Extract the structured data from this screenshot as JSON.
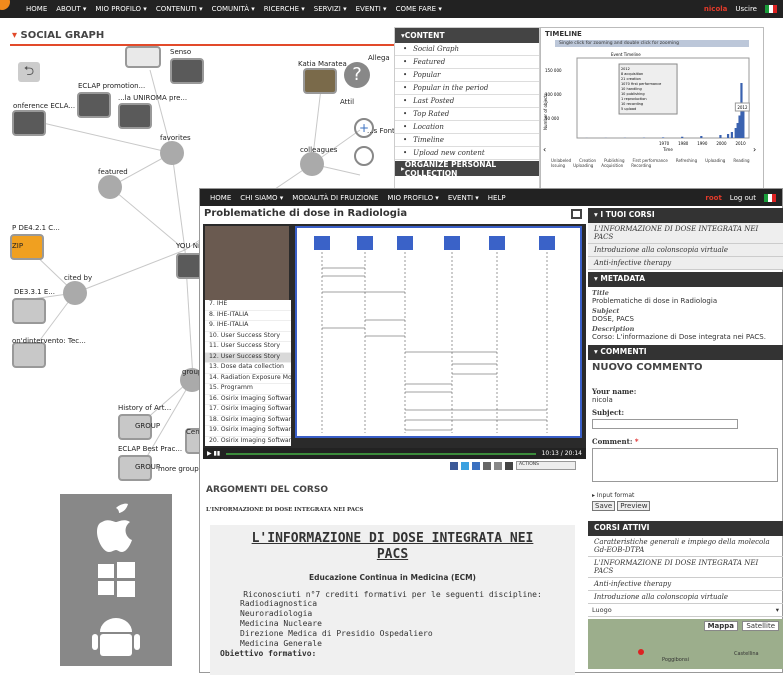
{
  "top": {
    "nav": [
      "HOME",
      "ABOUT ▾",
      "MIO PROFILO ▾",
      "CONTENUTI ▾",
      "COMUNITÀ ▾",
      "RICERCHE ▾",
      "SERVIZI ▾",
      "EVENTI ▾",
      "COME FARE ▾"
    ],
    "user": "nicola",
    "logout": "Uscire"
  },
  "graph": {
    "title": "SOCIAL GRAPH",
    "labels": [
      {
        "t": "Senso"
      },
      {
        "t": "ECLAP promotion..."
      },
      {
        "t": "...la UNIROMA pre..."
      },
      {
        "t": "onference ECLA..."
      },
      {
        "t": "favorites"
      },
      {
        "t": "featured"
      },
      {
        "t": "Katia Maratea"
      },
      {
        "t": "Allega"
      },
      {
        "t": "colleagues"
      },
      {
        "t": "...s Fonte"
      },
      {
        "t": "Attil"
      },
      {
        "t": "YOU Ni"
      },
      {
        "t": "P DE4.2.1 C..."
      },
      {
        "t": "cited by"
      },
      {
        "t": "DE3.3.1 E..."
      },
      {
        "t": "on'dintervento: Tec..."
      },
      {
        "t": "History of Art..."
      },
      {
        "t": "ECLAP Best Prac..."
      },
      {
        "t": "group"
      },
      {
        "t": "Cen"
      },
      {
        "t": "more groups"
      },
      {
        "t": "GROUP"
      },
      {
        "t": "GROUP"
      },
      {
        "t": "ZIP"
      }
    ]
  },
  "content_menu": {
    "title": "CONTENT",
    "items": [
      "Social Graph",
      "Featured",
      "Popular",
      "Popular in the period",
      "Last Posted",
      "Top Rated",
      "Location",
      "Timeline",
      "Upload new content"
    ],
    "organize": "ORGANIZE PERSONAL COLLECTION"
  },
  "timeline": {
    "title": "TIMELINE",
    "hint": "Single click for zooming and double click for zooming",
    "chart_title": "Event Timeline",
    "xlabel": "Time",
    "ylabel": "Number of objects",
    "yticks": [
      "150 000",
      "100 000",
      "50 000"
    ],
    "xticks": [
      "1970",
      "1980",
      "1990",
      "2000",
      "2010"
    ],
    "stats": [
      "2012",
      "8 acquisition",
      "21 creation",
      "1070 first performance",
      "10 handling",
      "10 publishing",
      "1 reproduction",
      "10 recording",
      "5 upload"
    ],
    "box_year": "2012",
    "legend": [
      "Unlabeled",
      "Creation",
      "Publishing",
      "First performance",
      "Refreshing",
      "Uploading",
      "Reading",
      "Issuing",
      "Uploading",
      "Acquisition",
      "Recording"
    ],
    "chart_data": {
      "type": "bar",
      "x": [
        1930,
        1940,
        1950,
        1960,
        1970,
        1980,
        1990,
        2000,
        2004,
        2006,
        2008,
        2009,
        2010,
        2011,
        2012
      ],
      "values": [
        200,
        300,
        400,
        600,
        1200,
        2500,
        4000,
        6000,
        8000,
        12000,
        20000,
        30000,
        45000,
        110000,
        60000
      ],
      "xlabel": "Time",
      "ylabel": "Number of objects",
      "ylim": [
        0,
        160000
      ]
    }
  },
  "course": {
    "nav": [
      "HOME",
      "CHI SIAMO ▾",
      "MODALITÀ DI FRUIZIONE",
      "MIO PROFILO ▾",
      "EVENTI ▾",
      "HELP"
    ],
    "user": "root",
    "logout": "Log out",
    "title": "Problematiche di dose in Radiologia",
    "playlist": [
      "7. IHE",
      "8. IHE-ITALIA",
      "9. IHE-ITALIA",
      "10. User Success Story",
      "11. User Success Story",
      "12. User Success Story",
      "13. Dose data collection",
      "14. Radiation Exposure Monit",
      "15. Programm",
      "16. Osirix Imaging Software",
      "17. Osirix Imaging Software",
      "18. Osirix Imaging Software",
      "19. Osirix Imaging Software",
      "20. Osirix Imaging Software"
    ],
    "time": "10:13 / 20:14",
    "actions": "ACTIONS"
  },
  "args": {
    "title": "ARGOMENTI DEL CORSO",
    "sub": "L'INFORMAZIONE DI DOSE INTEGRATA NEI PACS",
    "heading": "L'INFORMAZIONE DI DOSE INTEGRATA NEI PACS",
    "ecm": "Educazione Continua in Medicina (ECM)",
    "credits": "Riconosciuti n°7 crediti formativi per le seguenti discipline:",
    "disciplines": [
      "Radiodiagnostica",
      "Neuroradiologia",
      "Medicina Nucleare",
      "Direzione Medica di Presidio Ospedaliero",
      "Medicina Generale"
    ],
    "obiettivo": "Obiettivo formativo:"
  },
  "side": {
    "corsi_title": "I TUOI CORSI",
    "corsi": [
      "L'INFORMAZIONE DI DOSE INTEGRATA NEI PACS",
      "Introduzione alla colonscopia virtuale",
      "Anti-infective therapy"
    ],
    "meta_title": "METADATA",
    "meta": [
      {
        "k": "Title",
        "v": "Problematiche di dose in Radiologia"
      },
      {
        "k": "Subject",
        "v": "DOSE, PACS"
      },
      {
        "k": "Description",
        "v": "Corso: L'informazione di Dose integrata nei PACS."
      }
    ],
    "comm_title": "COMMENTI",
    "new_comment": "NUOVO COMMENTO",
    "your_name": "Your name:",
    "name_val": "nicola",
    "subject": "Subject:",
    "comment": "Comment:",
    "input_format": "Input format",
    "save": "Save",
    "preview": "Preview",
    "attivi_title": "CORSI ATTIVI",
    "attivi": [
      "Caratteristiche generali e impiego della molecola Gd-EOB-DTPA",
      "L'INFORMAZIONE DI DOSE INTEGRATA NEI PACS",
      "Anti-infective therapy",
      "Introduzione alla colonscopia virtuale"
    ],
    "luogo": "Luogo",
    "mappa": "Mappa",
    "satellite": "Satellite",
    "places": [
      "Poggibonsi",
      "Castellina"
    ]
  }
}
